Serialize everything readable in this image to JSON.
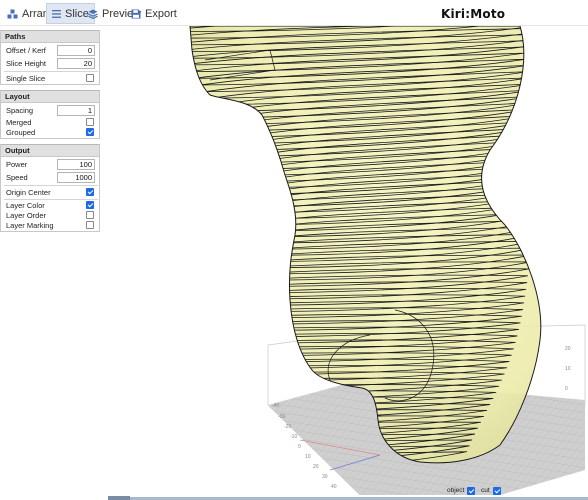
{
  "app": {
    "brand": "Kiri:Moto"
  },
  "tabs": [
    {
      "label": "Arrange",
      "icon": "arrange-icon",
      "active": false
    },
    {
      "label": "Slice",
      "icon": "list-icon",
      "active": true
    },
    {
      "label": "Preview",
      "icon": "layers-icon",
      "active": false
    },
    {
      "label": "Export",
      "icon": "save-icon",
      "active": false
    }
  ],
  "paths": {
    "title": "Paths",
    "offset_kerf": {
      "label": "Offset / Kerf",
      "value": "0"
    },
    "slice_height": {
      "label": "Slice Height",
      "value": "20"
    },
    "single_slice": {
      "label": "Single Slice",
      "checked": false
    }
  },
  "layout": {
    "title": "Layout",
    "spacing": {
      "label": "Spacing",
      "value": "1"
    },
    "merged": {
      "label": "Merged",
      "checked": false
    },
    "grouped": {
      "label": "Grouped",
      "checked": true
    }
  },
  "output": {
    "title": "Output",
    "power": {
      "label": "Power",
      "value": "100"
    },
    "speed": {
      "label": "Speed",
      "value": "1000"
    },
    "origin_center": {
      "label": "Origin Center",
      "checked": true
    },
    "layer_color": {
      "label": "Layer Color",
      "checked": true
    },
    "layer_order": {
      "label": "Layer Order",
      "checked": false
    },
    "layer_marking": {
      "label": "Layer Marking",
      "checked": false
    }
  },
  "viewport_toggles": {
    "object": {
      "label": "object",
      "checked": true
    },
    "cut": {
      "label": "cut",
      "checked": true
    }
  },
  "colors": {
    "accent": "#1d6ae5",
    "model_fill": "#f1f0a4",
    "slice_lines": "#1a1a1a",
    "bed": "#c8c8c8"
  }
}
